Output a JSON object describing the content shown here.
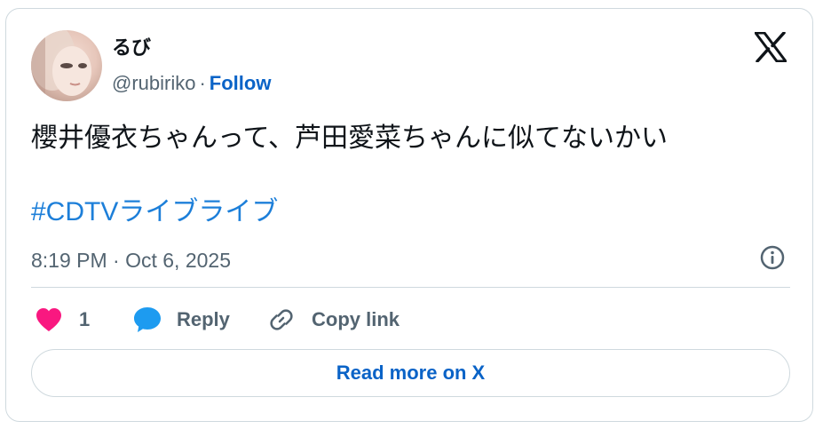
{
  "author": {
    "display_name": "るび",
    "handle": "@rubiriko",
    "separator": "·",
    "follow_label": "Follow",
    "avatar_icon": "user-avatar-photo"
  },
  "brand": {
    "logo_icon": "x-logo-icon"
  },
  "tweet": {
    "text": "櫻井優衣ちゃんって、芦田愛菜ちゃんに似てないかい",
    "hashtag": "#CDTVライブライブ",
    "timestamp": "8:19 PM · Oct 6, 2025"
  },
  "actions": {
    "like_count": "1",
    "reply_label": "Reply",
    "copy_link_label": "Copy link",
    "read_more_label": "Read more on X"
  },
  "colors": {
    "like_heart": "#f91880",
    "reply_bubble": "#1d9bf0",
    "link_blue": "#0a63c7",
    "hashtag_blue": "#1d7fd9",
    "muted_text": "#536471",
    "border": "#cfd9de"
  }
}
